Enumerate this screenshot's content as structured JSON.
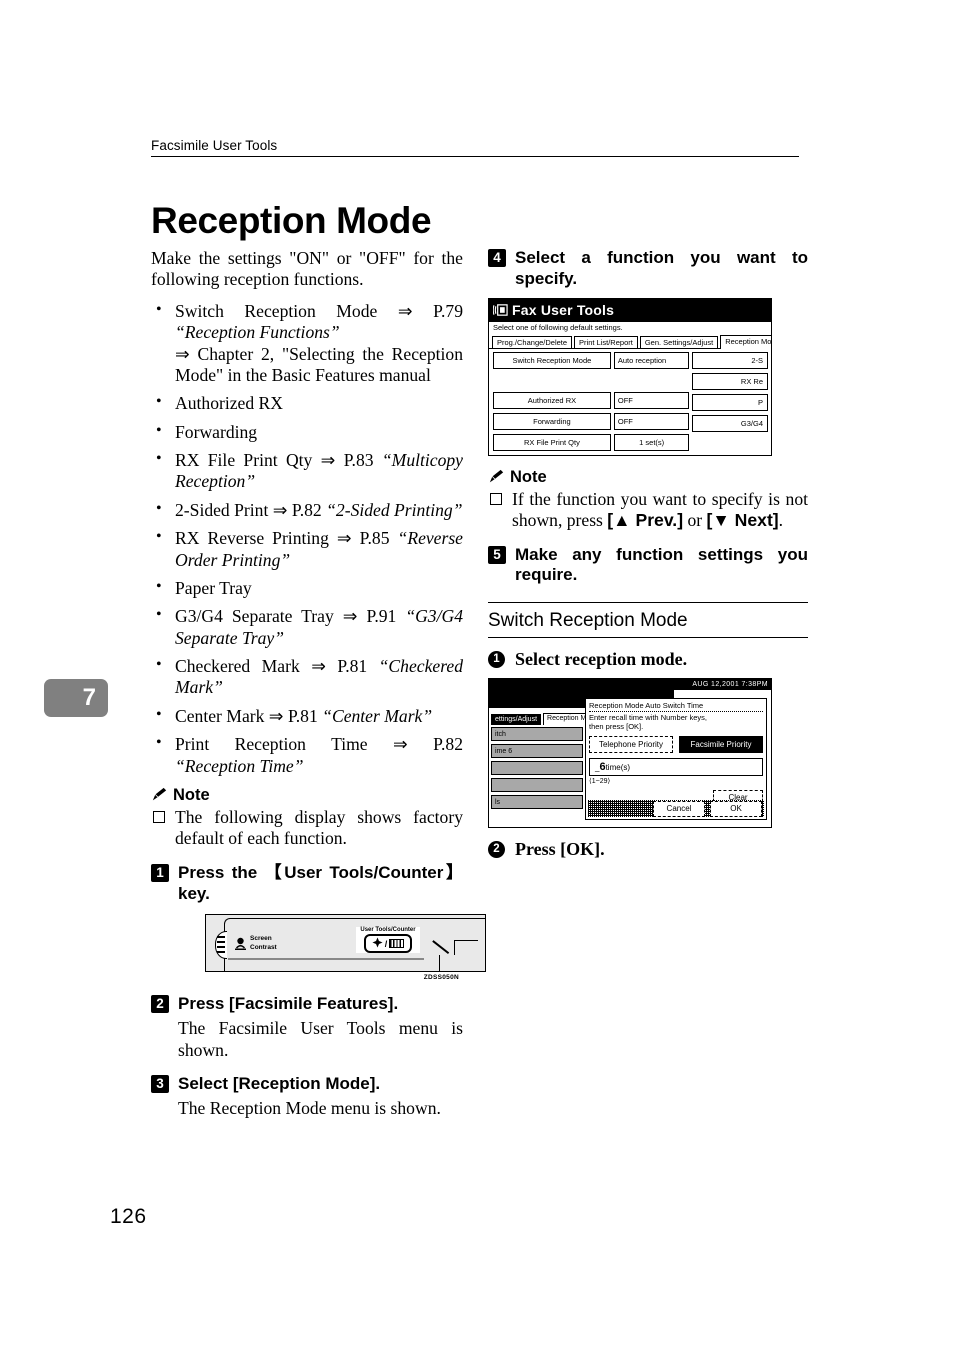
{
  "running_head": "Facsimile User Tools",
  "page_title": "Reception Mode",
  "chapter_tab": "7",
  "page_number": "126",
  "left_column": {
    "intro": "Make the settings \"ON\" or \"OFF\" for the following reception functions.",
    "bullets": [
      {
        "main": "Switch Reception Mode ⇒ P.79",
        "italic": "“Reception Functions”",
        "sub": "⇒ Chapter 2, \"Selecting the Reception Mode\" in the Basic Features manual"
      },
      {
        "main": "Authorized RX"
      },
      {
        "main": "Forwarding"
      },
      {
        "main": "RX File Print Qty ⇒ P.83 ",
        "italic": "“Multicopy Reception”"
      },
      {
        "main": "2-Sided Print ⇒ P.82 ",
        "italic": "“2-Sided Printing”"
      },
      {
        "main": "RX Reverse Printing ⇒ P.85 ",
        "italic": "“Reverse Order Printing”"
      },
      {
        "main": "Paper Tray"
      },
      {
        "main": "G3/G4 Separate Tray ⇒ P.91 ",
        "italic": "“G3/G4 Separate Tray”"
      },
      {
        "main": "Checkered Mark ⇒ P.81 ",
        "italic": "“Checkered Mark”"
      },
      {
        "main": "Center Mark ⇒ P.81 ",
        "italic": "“Center Mark”"
      },
      {
        "main": "Print Reception Time ⇒ P.82 ",
        "italic": "“Reception Time”"
      }
    ],
    "note_label": "Note",
    "note_items": [
      "The following display shows factory default of each function."
    ],
    "steps": [
      {
        "num": "1",
        "title_pre": "Press the ",
        "title_key": "【User Tools/Counter】",
        "title_post": " key."
      },
      {
        "num": "2",
        "title_pre": "Press ",
        "title_key": "[Facsimile Features]",
        "title_post": ".",
        "body": "The Facsimile User Tools menu is shown."
      },
      {
        "num": "3",
        "title_pre": "Select ",
        "title_key": "[Reception Mode]",
        "title_post": ".",
        "body": "The Reception Mode menu is shown."
      }
    ],
    "panel_illustration": {
      "contrast_label_line1": "Screen",
      "contrast_label_line2": "Contrast",
      "user_tools_label": "User Tools/Counter",
      "figure_code": "ZDSS050N"
    }
  },
  "right_column": {
    "steps": [
      {
        "num": "4",
        "title": "Select a function you want to specify."
      },
      {
        "num": "5",
        "title": "Make any function settings you require."
      }
    ],
    "note_label": "Note",
    "note_text_pre": "If the function you want to specify is not shown, press ",
    "note_key_prev": "[▲ Prev.]",
    "note_text_mid": " or ",
    "note_key_next": "[▼ Next]",
    "note_text_post": ".",
    "subsection_title": "Switch Reception Mode",
    "circled_steps": [
      {
        "num": "1",
        "text": "Select reception mode."
      },
      {
        "num": "2",
        "text": "Press [OK]."
      }
    ],
    "lcd_user_tools": {
      "title": "Fax User Tools",
      "hint": "Select one of following default settings.",
      "tabs": [
        {
          "label": "Prog./Change/Delete",
          "active": false
        },
        {
          "label": "Print List/Report",
          "active": false
        },
        {
          "label": "Gen. Settings/Adjust",
          "active": false
        },
        {
          "label": "Reception Mode",
          "active": true
        }
      ],
      "rows": [
        {
          "name": "Switch Reception Mode",
          "value": "Auto reception",
          "right": "2-S"
        },
        {
          "name": "",
          "value": "",
          "right": "RX Re"
        },
        {
          "name": "Authorized RX",
          "value": "OFF",
          "right": "P"
        },
        {
          "name": "Forwarding",
          "value": "OFF",
          "right": "G3/G4"
        },
        {
          "name": "RX File Print Qty",
          "value": "1 set(s)",
          "right": ""
        }
      ]
    },
    "lcd_switch_mode": {
      "status_bar": "AUG  12,2001  7:38PM",
      "bg_tabs": [
        {
          "label": "ettings/Adjust",
          "active": true
        },
        {
          "label": "Reception M",
          "active": false
        }
      ],
      "bg_rows": [
        {
          "label": "itch"
        },
        {
          "label": "ime     6"
        },
        {
          "label": ""
        },
        {
          "label": ""
        },
        {
          "label": "ls"
        }
      ],
      "dialog": {
        "title": "Reception Mode Auto Switch Time",
        "instruction_line1": "Enter recall time with Number keys,",
        "instruction_line2": "then press [OK].",
        "choice_telephone": "Telephone Priority",
        "choice_facsimile": "Facsimile Priority",
        "selected_choice": "Facsimile Priority",
        "field_cursor": "_",
        "field_value": "6",
        "field_unit": "time(s)",
        "range": "⟨1~29⟩",
        "clear_label": "Clear",
        "cancel_label": "Cancel",
        "ok_label": "OK"
      }
    }
  }
}
